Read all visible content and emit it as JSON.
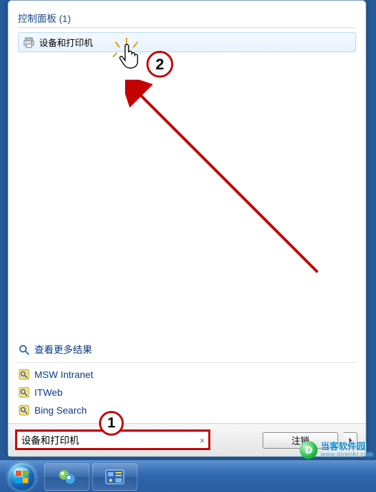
{
  "section": {
    "title": "控制面板 (1)"
  },
  "result": {
    "label": "设备和打印机"
  },
  "links": {
    "more": "查看更多结果",
    "items": [
      "MSW Intranet",
      "ITWeb",
      "Bing Search"
    ]
  },
  "search": {
    "value": "设备和打印机",
    "clear": "×"
  },
  "logout": {
    "label": "注销"
  },
  "annotations": {
    "step1": "1",
    "step2": "2"
  },
  "watermark": {
    "brand": "当客软件园",
    "url": "www.downkr.com"
  }
}
